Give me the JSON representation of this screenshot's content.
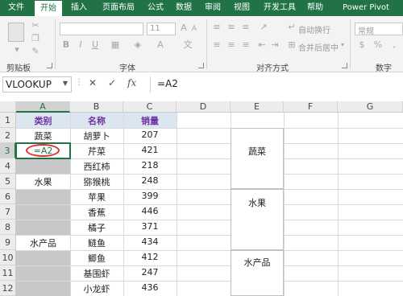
{
  "tabs": [
    "文件",
    "开始",
    "插入",
    "页面布局",
    "公式",
    "数据",
    "审阅",
    "视图",
    "开发工具",
    "帮助",
    "Power Pivot"
  ],
  "ribbon": {
    "groups": {
      "clipboard": "剪贴板",
      "font": "字体",
      "alignment": "对齐方式",
      "number": "数字"
    },
    "font_size": "11",
    "font_buttons": [
      "B",
      "I",
      "U"
    ],
    "wrap_text": "自动换行",
    "merge_center": "合并后居中",
    "number_format": "常规"
  },
  "formula_bar": {
    "name_box": "VLOOKUP",
    "cancel": "✕",
    "enter": "✓",
    "fx": "fx",
    "formula": "=A2"
  },
  "sheet": {
    "columns": [
      "A",
      "B",
      "C",
      "D",
      "E",
      "F",
      "G"
    ],
    "rows": [
      "1",
      "2",
      "3",
      "4",
      "5",
      "6",
      "7",
      "8",
      "9",
      "10",
      "11",
      "12"
    ],
    "headers": {
      "a1": "类别",
      "b1": "名称",
      "c1": "销量"
    },
    "category_cells": {
      "a2": "蔬菜",
      "a3": "=A2",
      "a5": "水果",
      "a9": "水产品"
    },
    "items": [
      {
        "name": "胡萝卜",
        "qty": "207"
      },
      {
        "name": "芹菜",
        "qty": "421"
      },
      {
        "name": "西红柿",
        "qty": "218"
      },
      {
        "name": "猕猴桃",
        "qty": "248"
      },
      {
        "name": "苹果",
        "qty": "399"
      },
      {
        "name": "香蕉",
        "qty": "446"
      },
      {
        "name": "橘子",
        "qty": "371"
      },
      {
        "name": "鲢鱼",
        "qty": "434"
      },
      {
        "name": "鲫鱼",
        "qty": "412"
      },
      {
        "name": "基围虾",
        "qty": "247"
      },
      {
        "name": "小龙虾",
        "qty": "436"
      }
    ],
    "column_e": {
      "e4": "蔬菜",
      "e7": "水果",
      "e10": "水产品"
    }
  },
  "colors": {
    "excel_green": "#217346",
    "header_purple": "#7030a0",
    "highlight_red": "#e03030",
    "gray_fill": "#c8c8c8"
  }
}
